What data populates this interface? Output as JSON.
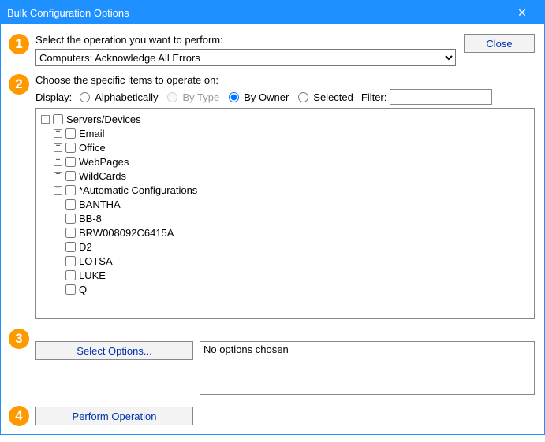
{
  "window": {
    "title": "Bulk Configuration Options",
    "close_x": "✕"
  },
  "close_button": "Close",
  "step1": {
    "label": "Select the operation you want to perform:",
    "operation": "Computers:  Acknowledge All Errors"
  },
  "step2": {
    "label": "Choose the specific items to operate on:",
    "display_label": "Display:",
    "radios": {
      "alpha": "Alphabetically",
      "bytype": "By Type",
      "byowner": "By Owner",
      "selected": "Selected"
    },
    "filter_label": "Filter:",
    "filter_value": "",
    "tree": {
      "root": "Servers/Devices",
      "groups": [
        "Email",
        "Office",
        "WebPages",
        "WildCards",
        "*Automatic Configurations"
      ],
      "leaves": [
        "BANTHA",
        "BB-8",
        "BRW008092C6415A",
        "D2",
        "LOTSA",
        "LUKE",
        "Q"
      ]
    }
  },
  "step3": {
    "button": "Select Options...",
    "text": "No options chosen"
  },
  "step4": {
    "button": "Perform Operation"
  },
  "badges": {
    "s1": "1",
    "s2": "2",
    "s3": "3",
    "s4": "4"
  }
}
